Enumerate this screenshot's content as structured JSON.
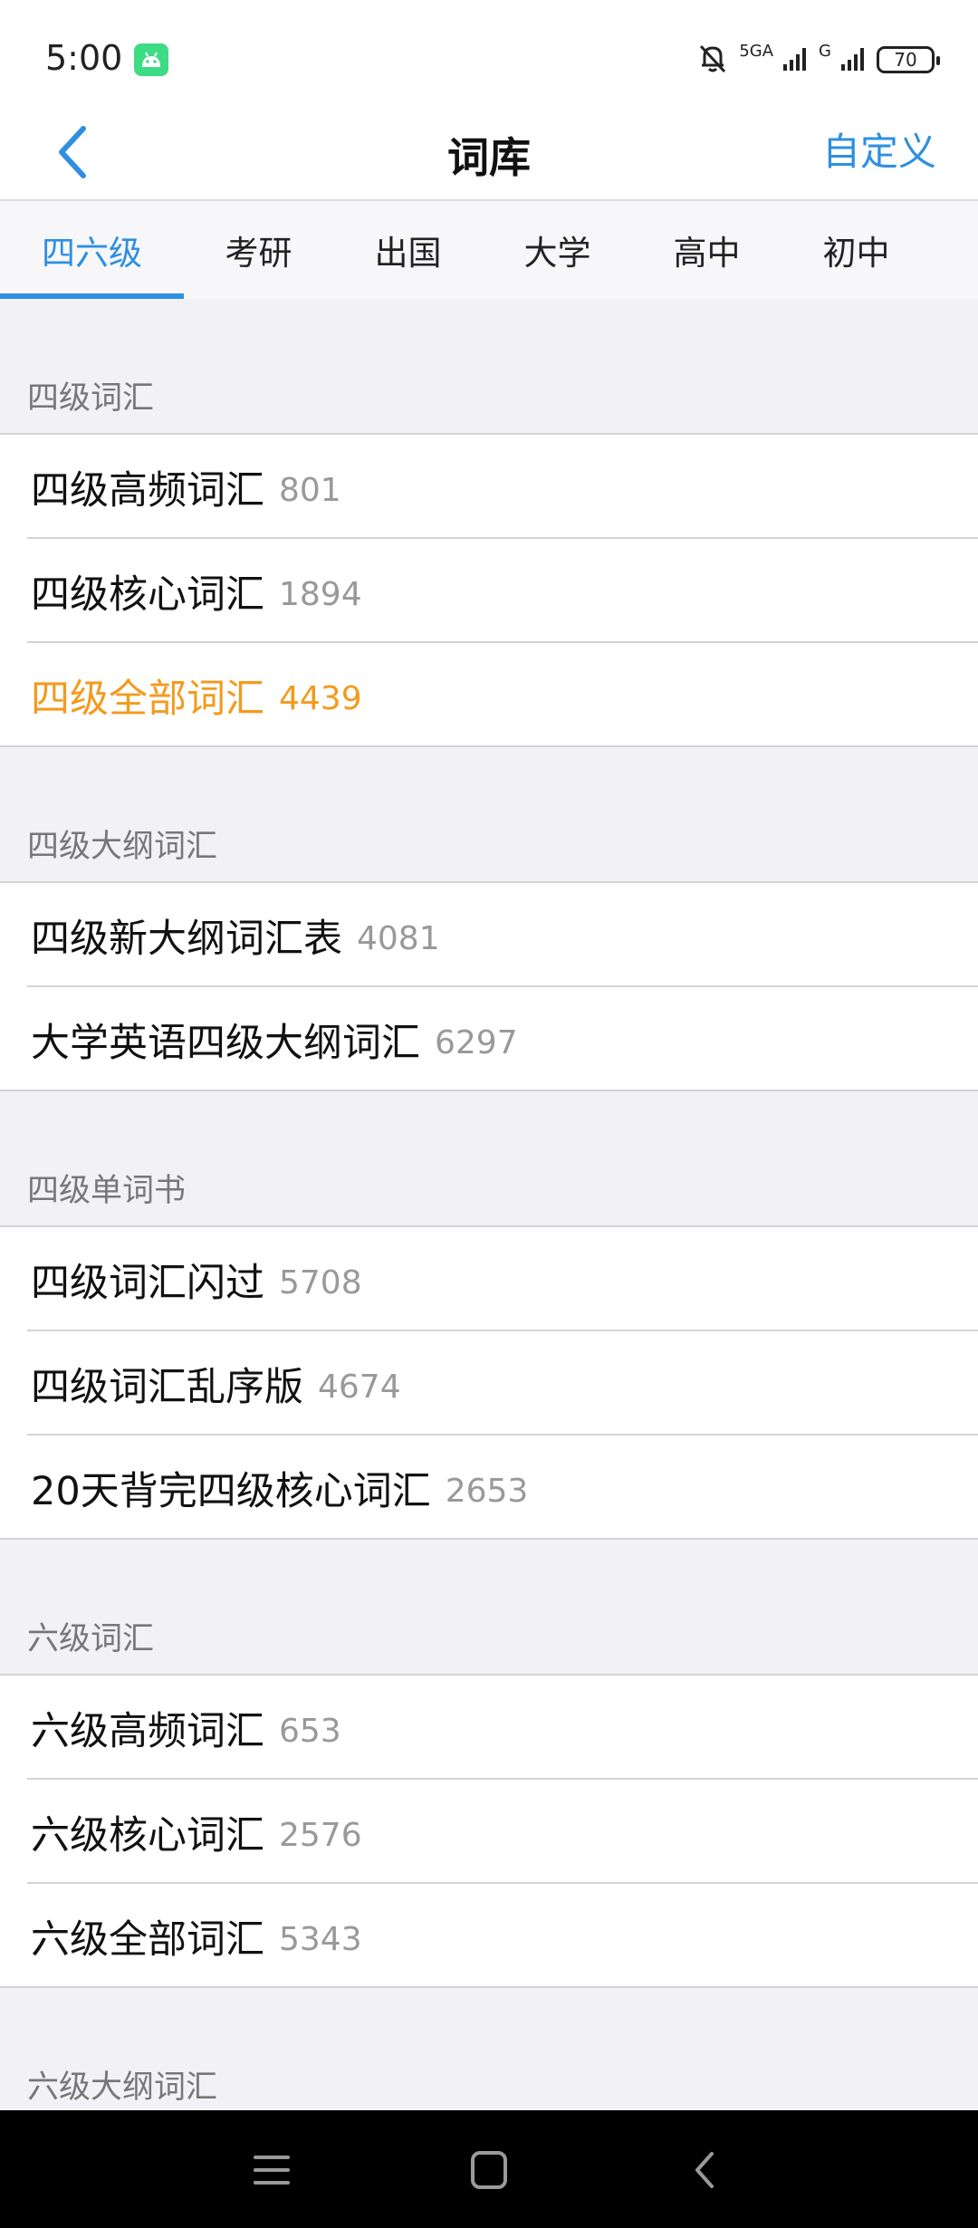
{
  "status_bar": {
    "time": "5:00",
    "network_1": "5GA",
    "network_2": "G",
    "battery": "70",
    "icons": [
      "android-app-icon",
      "bell-muted-icon",
      "signal-icon",
      "signal-icon",
      "battery-icon"
    ]
  },
  "header": {
    "back_icon": "chevron-left-icon",
    "title": "词库",
    "custom_label": "自定义"
  },
  "tabs": [
    {
      "label": "四六级",
      "active": true
    },
    {
      "label": "考研"
    },
    {
      "label": "出国"
    },
    {
      "label": "大学"
    },
    {
      "label": "高中"
    },
    {
      "label": "初中"
    }
  ],
  "sections": [
    {
      "title": "四级词汇",
      "items": [
        {
          "name": "四级高频词汇",
          "count": "801"
        },
        {
          "name": "四级核心词汇",
          "count": "1894"
        },
        {
          "name": "四级全部词汇",
          "count": "4439",
          "highlight": true
        }
      ]
    },
    {
      "title": "四级大纲词汇",
      "items": [
        {
          "name": "四级新大纲词汇表",
          "count": "4081"
        },
        {
          "name": "大学英语四级大纲词汇",
          "count": "6297"
        }
      ]
    },
    {
      "title": "四级单词书",
      "items": [
        {
          "name": "四级词汇闪过",
          "count": "5708"
        },
        {
          "name": "四级词汇乱序版",
          "count": "4674"
        },
        {
          "name": "20天背完四级核心词汇",
          "count": "2653"
        }
      ]
    },
    {
      "title": "六级词汇",
      "items": [
        {
          "name": "六级高频词汇",
          "count": "653"
        },
        {
          "name": "六级核心词汇",
          "count": "2576"
        },
        {
          "name": "六级全部词汇",
          "count": "5343"
        }
      ]
    },
    {
      "title": "六级大纲词汇",
      "items": []
    }
  ],
  "system_nav": {
    "icons": [
      "menu-icon",
      "home-square-icon",
      "back-chevron-icon"
    ]
  },
  "colors": {
    "accent": "#2f8fe0",
    "highlight": "#f39a1e",
    "background": "#f2f2f6"
  }
}
